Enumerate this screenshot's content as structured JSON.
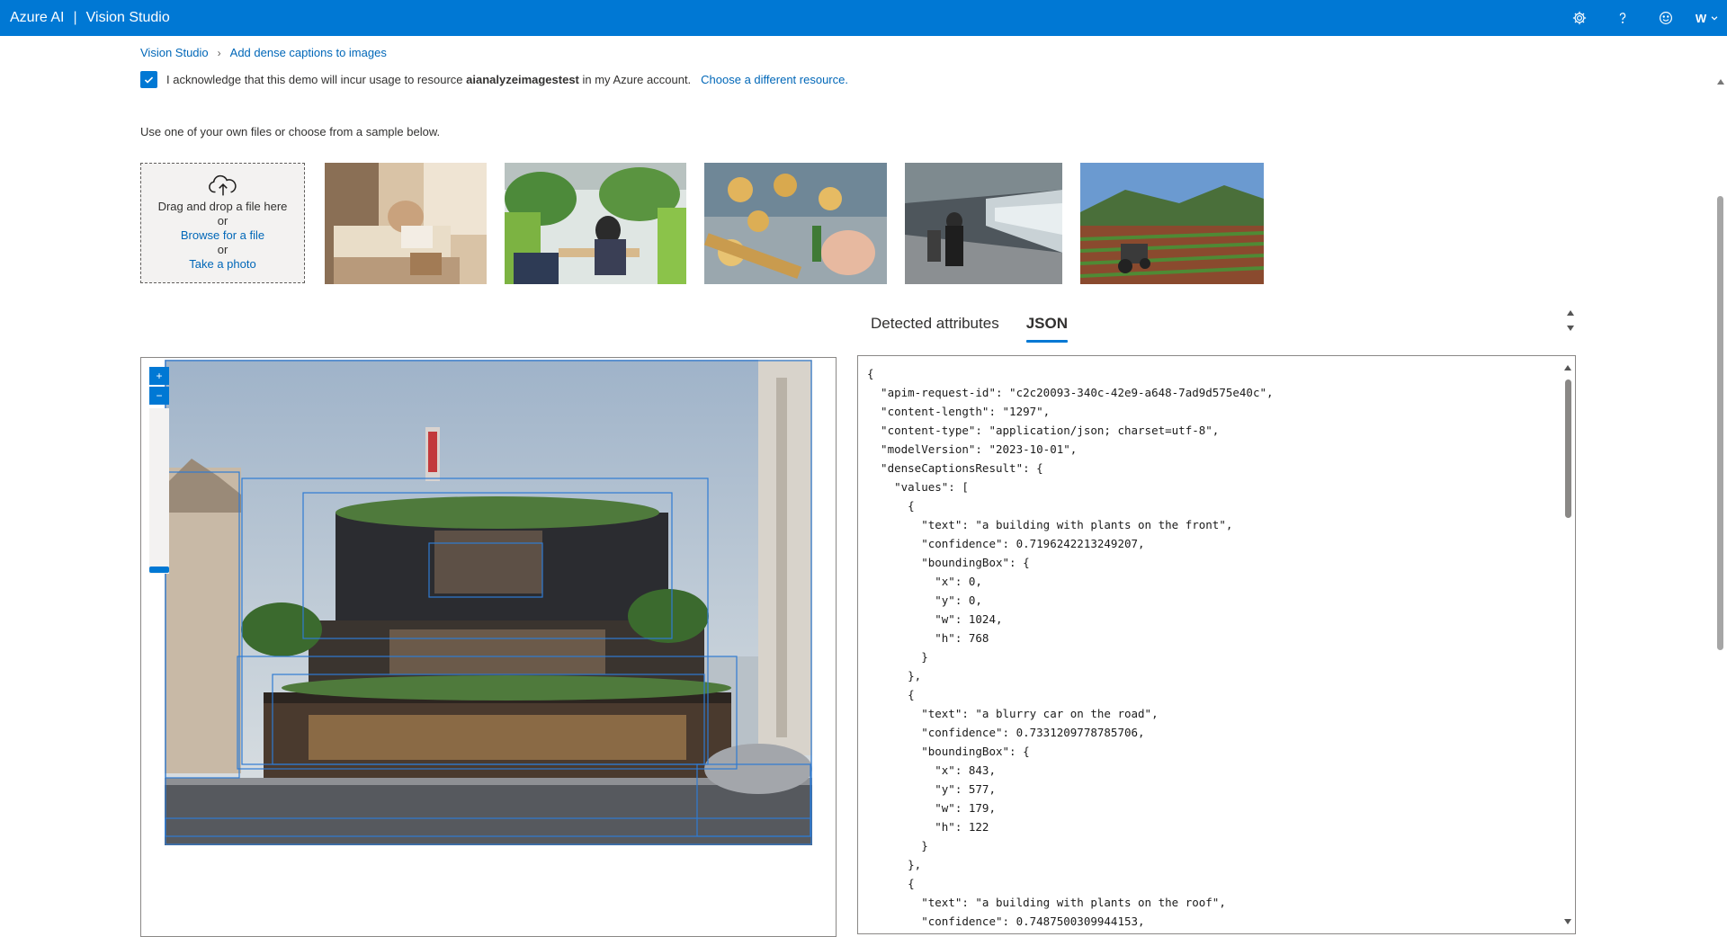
{
  "app": {
    "brand": "Azure AI",
    "product": "Vision Studio",
    "user_initial": "W",
    "accent": "#0078d4"
  },
  "topbar": {
    "icons": [
      "gear-icon",
      "help-icon",
      "smiley-icon",
      "chevron-down-icon"
    ]
  },
  "breadcrumb": {
    "items": [
      "Vision Studio",
      "Add dense captions to images"
    ]
  },
  "acknowledgement": {
    "checked": true,
    "prefix": "I acknowledge that this demo will incur usage to resource",
    "resource": "aianalyzeimagestest",
    "suffix": "in my Azure account.",
    "change_link": "Choose a different resource."
  },
  "intro": "Use one of your own files or choose from a sample below.",
  "upload": {
    "drag_text": "Drag and drop a file here",
    "or1": "or",
    "browse_link": "Browse for a file",
    "or2": "or",
    "photo_link": "Take a photo"
  },
  "tabs": [
    {
      "label": "Detected attributes",
      "active": false
    },
    {
      "label": "JSON",
      "active": true
    }
  ],
  "json_lines": [
    "{",
    "  \"apim-request-id\": \"c2c20093-340c-42e9-a648-7ad9d575e40c\",",
    "  \"content-length\": \"1297\",",
    "  \"content-type\": \"application/json; charset=utf-8\",",
    "  \"modelVersion\": \"2023-10-01\",",
    "  \"denseCaptionsResult\": {",
    "    \"values\": [",
    "      {",
    "        \"text\": \"a building with plants on the front\",",
    "        \"confidence\": 0.7196242213249207,",
    "        \"boundingBox\": {",
    "          \"x\": 0,",
    "          \"y\": 0,",
    "          \"w\": 1024,",
    "          \"h\": 768",
    "        }",
    "      },",
    "      {",
    "        \"text\": \"a blurry car on the road\",",
    "        \"confidence\": 0.7331209778785706,",
    "        \"boundingBox\": {",
    "          \"x\": 843,",
    "          \"y\": 577,",
    "          \"w\": 179,",
    "          \"h\": 122",
    "        }",
    "      },",
    "      {",
    "        \"text\": \"a building with plants on the roof\",",
    "        \"confidence\": 0.7487500309944153,"
  ]
}
